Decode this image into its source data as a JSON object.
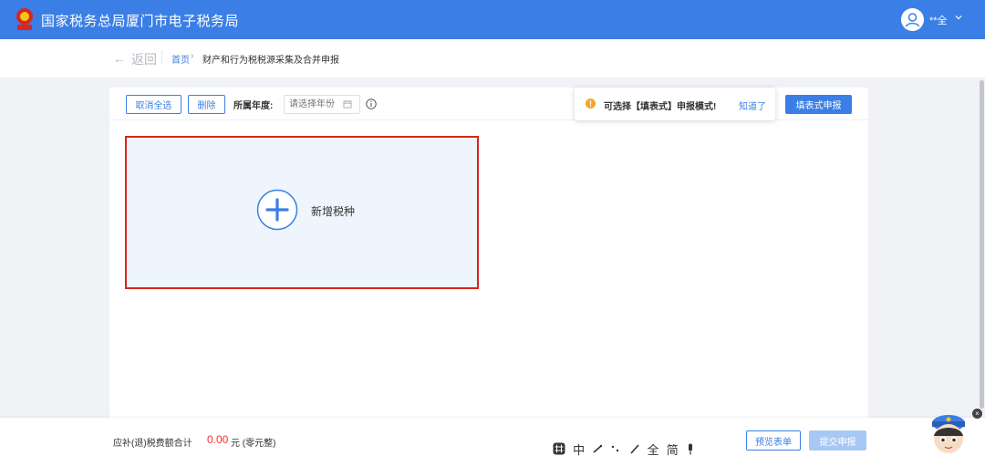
{
  "header": {
    "site_title": "国家税务总局厦门市电子税务局",
    "user_name": "**全",
    "brand_color": "#3b7fe6"
  },
  "breadcrumb": {
    "back_label": "返回",
    "home_label": "首页",
    "separator": "›",
    "current_label": "财产和行为税税源采集及合并申报"
  },
  "toolbar": {
    "cancel_all_label": "取消全选",
    "delete_label": "删除",
    "year_label": "所属年度:",
    "year_placeholder": "请选择年份",
    "form_declare_label": "填表式申报"
  },
  "notice": {
    "icon_text": "!",
    "message": "可选择【填表式】申报模式!",
    "ok_label": "知道了"
  },
  "main": {
    "add_tax_label": "新增税种",
    "highlight_color": "#d9261c"
  },
  "footer": {
    "total_label": "应补(退)税费额合计",
    "total_amount": "0.00",
    "total_suffix": "元 (零元整)",
    "preview_label": "预览表单",
    "submit_label": "提交申报"
  },
  "ime_bar": {
    "items": [
      "中",
      "全",
      "简"
    ]
  }
}
